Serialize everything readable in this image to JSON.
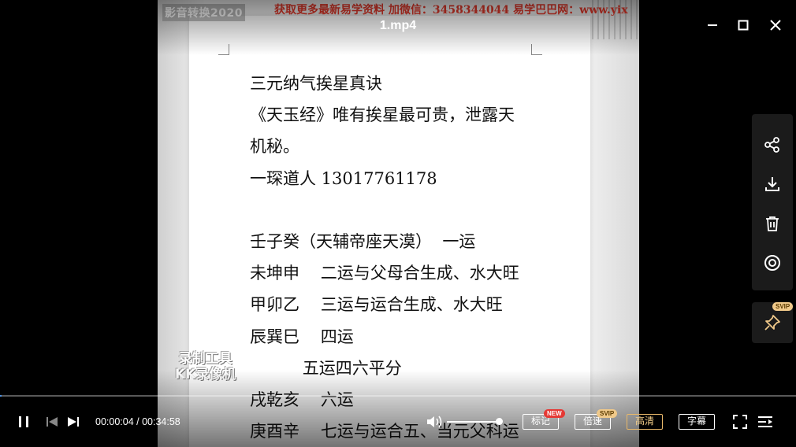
{
  "window": {
    "title": "1.mp4"
  },
  "video": {
    "watermark_top_left": "影音转换2020",
    "watermark_top_right": "获取更多最新易学资料 加微信：3458344044 易学巴巴网：www.yix",
    "watermark_recorder": [
      "录制工具",
      "KK录像机"
    ],
    "document_lines": [
      "三元纳气挨星真诀",
      "《天玉经》唯有挨星最可贵，泄露天",
      "机秘。",
      "一琛道人 13017761178",
      "",
      "壬子癸（天辅帝座天漠）  一运",
      "未坤申    二运与父母合生成、水大旺",
      "甲卯乙    三运与运合生成、水大旺",
      "辰巽巳    四运",
      "          五运四六平分",
      "戌乾亥    六运",
      "庚酉辛    七运与运合五、当元父科运"
    ]
  },
  "side_panel": {
    "items": [
      {
        "icon": "share-icon"
      },
      {
        "icon": "download-icon"
      },
      {
        "icon": "trash-icon"
      },
      {
        "icon": "screenshot-icon"
      }
    ],
    "pin": {
      "icon": "pin-icon",
      "badge": "SVIP"
    }
  },
  "controls": {
    "current_time": "00:00:04",
    "total_time": "00:34:58",
    "time_text": "00:00:04 / 00:34:58",
    "progress_fraction": 0.0019,
    "volume_fraction": 0.95,
    "mark_label": "标记",
    "mark_badge": "NEW",
    "speed_label": "倍速",
    "speed_badge": "SVIP",
    "quality_label": "高清",
    "subtitle_label": "字幕"
  },
  "colors": {
    "progress": "#4a90e2",
    "watermark_red": "#e6392b",
    "quality_gold": "#f2cd8a",
    "new_badge": "#e53935",
    "svip_badge": "#f0c98a"
  }
}
